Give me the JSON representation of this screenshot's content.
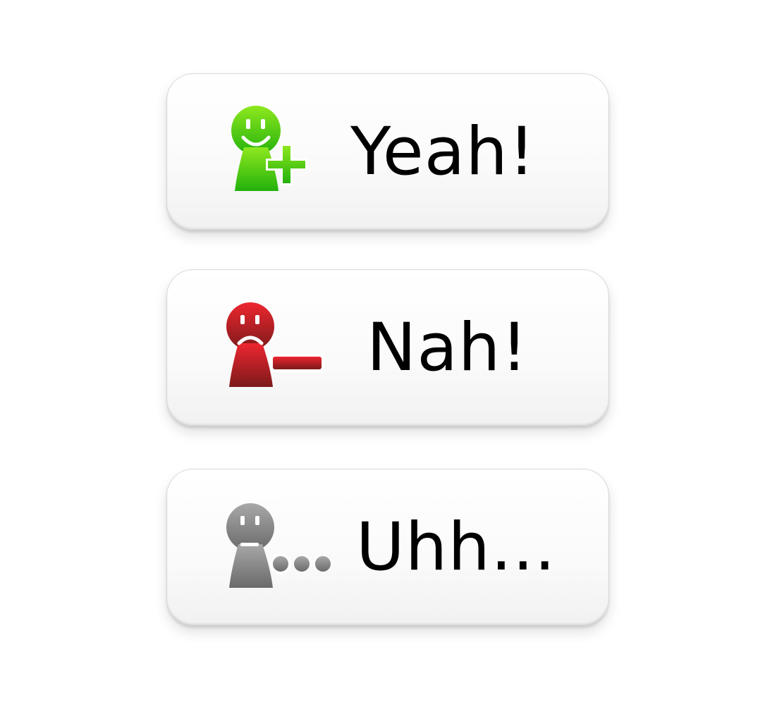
{
  "buttons": [
    {
      "label": "Yeah!",
      "icon": "person-add-happy-icon",
      "color": "#3fbf12"
    },
    {
      "label": "Nah!",
      "icon": "person-remove-sad-icon",
      "color": "#c8202a"
    },
    {
      "label": "Uhh...",
      "icon": "person-pending-neutral-icon",
      "color": "#8a8a8a"
    }
  ]
}
